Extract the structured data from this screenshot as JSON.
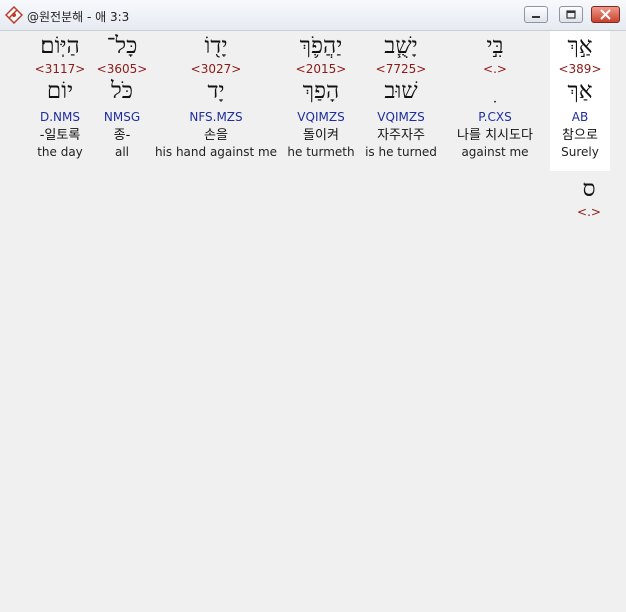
{
  "window": {
    "title": "@원전분해 - 애 3:3",
    "icons": {
      "app": "app-logo-icon",
      "minimize": "minimize-icon",
      "maximize": "maximize-icon",
      "close": "close-icon"
    }
  },
  "words": [
    {
      "hebrew": "אַ֣ךְ",
      "strong": "<389>",
      "lemma": "אַךְ",
      "parsing": "AB",
      "korean": "참으로",
      "english": "Surely"
    },
    {
      "hebrew": "בִּ֣י",
      "strong": "<.>",
      "lemma": "ׅ",
      "parsing": "P.CXS",
      "korean": "나를 치시도다",
      "english": "against me"
    },
    {
      "hebrew": "יָשֻׁ֧ב",
      "strong": "<7725>",
      "lemma": "שׁוּב",
      "parsing": "VQIMZS",
      "korean": "자주자주",
      "english": "is he turned"
    },
    {
      "hebrew": "יַהֲפֹ֛ךְ",
      "strong": "<2015>",
      "lemma": "הָפַךְ",
      "parsing": "VQIMZS",
      "korean": "돌이켜",
      "english": "he turmeth"
    },
    {
      "hebrew": "יָד֖וֹ",
      "strong": "<3027>",
      "lemma": "יָד",
      "parsing": "NFS.MZS",
      "korean": "손을",
      "english": "his hand against me"
    },
    {
      "hebrew": "כָּל־",
      "strong": "<3605>",
      "lemma": "כֹּל",
      "parsing": "NMSG",
      "korean": "종-",
      "english": "all"
    },
    {
      "hebrew": "הַיּֽוֹם׃",
      "strong": "<3117>",
      "lemma": "יוֹם",
      "parsing": "D.NMS",
      "korean": "-일토록",
      "english": "the day"
    }
  ],
  "trailer": {
    "hebrew": "ס",
    "strong": "<.>"
  }
}
